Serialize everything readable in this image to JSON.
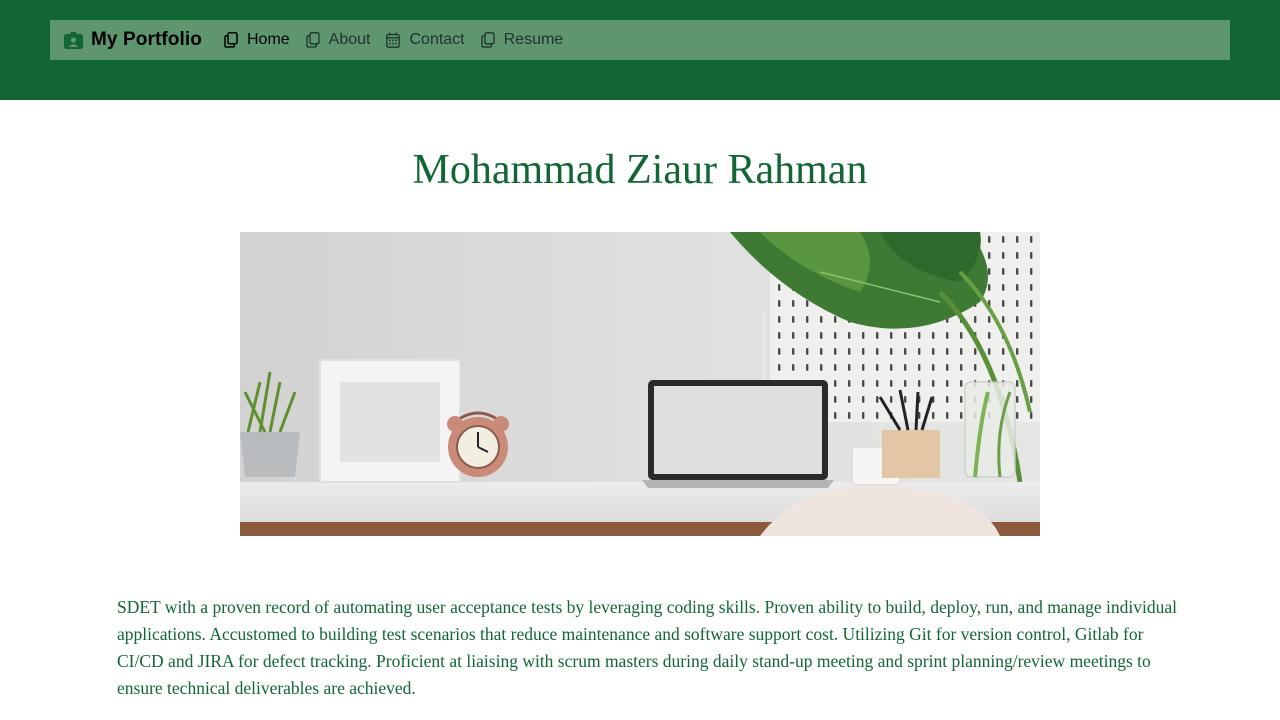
{
  "colors": {
    "brand_green": "#116633",
    "nav_bar": "#5e9670",
    "background": "#ffffff"
  },
  "navbar": {
    "brand_label": "My Portfolio",
    "brand_icon": "person-badge-icon",
    "items": [
      {
        "label": "Home",
        "icon": "files-icon",
        "active": true
      },
      {
        "label": "About",
        "icon": "files-icon",
        "active": false
      },
      {
        "label": "Contact",
        "icon": "calendar-icon",
        "active": false
      },
      {
        "label": "Resume",
        "icon": "files-icon",
        "active": false
      }
    ]
  },
  "hero": {
    "title": "Mohammad Ziaur Rahman",
    "image_subject": "desk-workspace-photo"
  },
  "bio": {
    "text": "SDET with a proven record of automating user acceptance tests by leveraging coding skills. Proven ability to build, deploy, run, and manage individual applications. Accustomed to building test scenarios that reduce maintenance and software support cost. Utilizing Git for version control, Gitlab for CI/CD and JIRA for defect tracking. Proficient at liaising with scrum masters during daily stand-up meeting and sprint planning/review meetings to ensure technical deliverables are achieved."
  }
}
